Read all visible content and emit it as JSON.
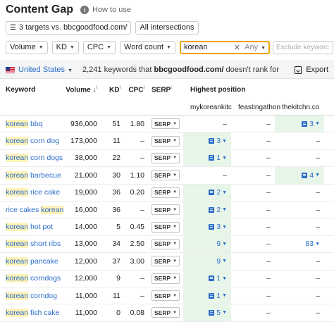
{
  "header": {
    "title": "Content Gap",
    "help_label": "How to use"
  },
  "filters": {
    "targets": "3 targets vs. bbcgoodfood.com/",
    "intersections": "All intersections",
    "volume": "Volume",
    "kd": "KD",
    "cpc": "CPC",
    "word_count": "Word count",
    "search_value": "korean",
    "match_mode": "Any",
    "exclude_placeholder": "Exclude keyworc"
  },
  "summary": {
    "country": "United States",
    "count_text": "2,241 keywords that",
    "domain": "bbcgoodfood.com/",
    "suffix": "doesn't rank for",
    "export_label": "Export"
  },
  "table": {
    "headers": {
      "keyword": "Keyword",
      "volume": "Volume",
      "kd": "KD",
      "cpc": "CPC",
      "serp": "SERP",
      "highest_position": "Highest position",
      "site1": "mykoreankitc",
      "site2": "feastingathon",
      "site3": "thekitchn.co"
    },
    "serp_label": "SERP",
    "rows": [
      {
        "kw_pre": "",
        "kw_hl": "korean",
        "kw_post": " bbq",
        "volume": "936,000",
        "kd": "51",
        "cpc": "1.80",
        "p1": "–",
        "p2": "–",
        "p3": "3",
        "g1": false,
        "g3": true,
        "s1": false,
        "s3": true
      },
      {
        "kw_pre": "",
        "kw_hl": "korean",
        "kw_post": " corn dog",
        "volume": "173,000",
        "kd": "11",
        "cpc": "–",
        "p1": "3",
        "p2": "–",
        "p3": "–",
        "g1": true,
        "g3": false,
        "s1": true,
        "s3": false
      },
      {
        "kw_pre": "",
        "kw_hl": "korean",
        "kw_post": " corn dogs",
        "volume": "38,000",
        "kd": "22",
        "cpc": "–",
        "p1": "1",
        "p2": "–",
        "p3": "–",
        "g1": true,
        "g3": false,
        "s1": true,
        "s3": false
      },
      {
        "kw_pre": "",
        "kw_hl": "korean",
        "kw_post": " barbecue",
        "volume": "21,000",
        "kd": "30",
        "cpc": "1.10",
        "p1": "–",
        "p2": "–",
        "p3": "4",
        "g1": false,
        "g3": true,
        "s1": false,
        "s3": true
      },
      {
        "kw_pre": "",
        "kw_hl": "korean",
        "kw_post": " rice cake",
        "volume": "19,000",
        "kd": "36",
        "cpc": "0.20",
        "p1": "2",
        "p2": "–",
        "p3": "–",
        "g1": true,
        "g3": false,
        "s1": true,
        "s3": false
      },
      {
        "kw_pre": "rice cakes ",
        "kw_hl": "korean",
        "kw_post": "",
        "volume": "16,000",
        "kd": "36",
        "cpc": "–",
        "p1": "2",
        "p2": "–",
        "p3": "–",
        "g1": true,
        "g3": false,
        "s1": true,
        "s3": false
      },
      {
        "kw_pre": "",
        "kw_hl": "korean",
        "kw_post": " hot pot",
        "volume": "14,000",
        "kd": "5",
        "cpc": "0.45",
        "p1": "3",
        "p2": "–",
        "p3": "–",
        "g1": true,
        "g3": false,
        "s1": true,
        "s3": false
      },
      {
        "kw_pre": "",
        "kw_hl": "korean",
        "kw_post": " short ribs",
        "volume": "13,000",
        "kd": "34",
        "cpc": "2.50",
        "p1": "9",
        "p2": "–",
        "p3": "83",
        "g1": true,
        "g3": false,
        "s1": false,
        "s3": false
      },
      {
        "kw_pre": "",
        "kw_hl": "korean",
        "kw_post": " pancake",
        "volume": "12,000",
        "kd": "37",
        "cpc": "3.00",
        "p1": "9",
        "p2": "–",
        "p3": "–",
        "g1": true,
        "g3": false,
        "s1": false,
        "s3": false
      },
      {
        "kw_pre": "",
        "kw_hl": "korean",
        "kw_post": " corndogs",
        "volume": "12,000",
        "kd": "9",
        "cpc": "–",
        "p1": "1",
        "p2": "–",
        "p3": "–",
        "g1": true,
        "g3": false,
        "s1": true,
        "s3": false
      },
      {
        "kw_pre": "",
        "kw_hl": "korean",
        "kw_post": " corndog",
        "volume": "11,000",
        "kd": "11",
        "cpc": "–",
        "p1": "1",
        "p2": "–",
        "p3": "–",
        "g1": true,
        "g3": false,
        "s1": true,
        "s3": false
      },
      {
        "kw_pre": "",
        "kw_hl": "korean",
        "kw_post": " fish cake",
        "volume": "11,000",
        "kd": "0",
        "cpc": "0.08",
        "p1": "5",
        "p2": "–",
        "p3": "–",
        "g1": true,
        "g3": false,
        "s1": true,
        "s3": false
      }
    ]
  }
}
